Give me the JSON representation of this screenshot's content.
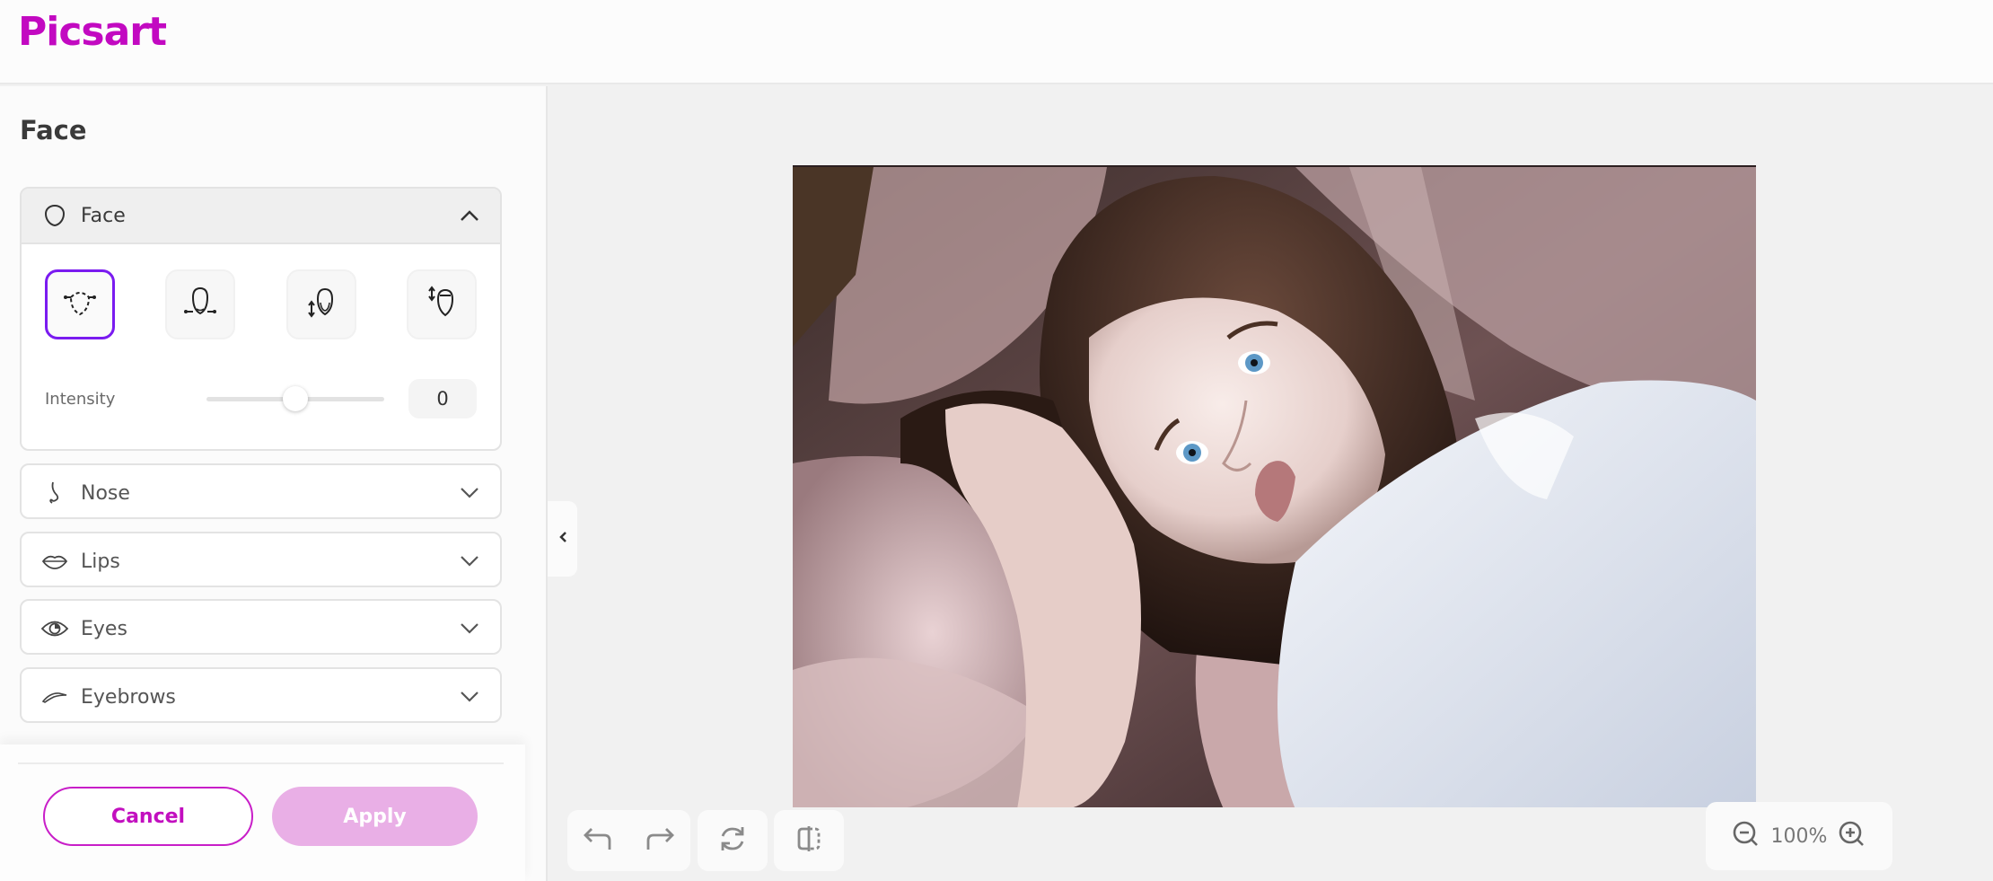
{
  "app": {
    "logo_text": "Picsart",
    "brand_color": "#c209c1"
  },
  "panel": {
    "title": "Face",
    "sections": [
      {
        "id": "face",
        "label": "Face",
        "icon": "face-outline-icon",
        "expanded": true
      },
      {
        "id": "nose",
        "label": "Nose",
        "icon": "nose-icon",
        "expanded": false
      },
      {
        "id": "lips",
        "label": "Lips",
        "icon": "lips-icon",
        "expanded": false
      },
      {
        "id": "eyes",
        "label": "Eyes",
        "icon": "eye-icon",
        "expanded": false
      },
      {
        "id": "eyebrows",
        "label": "Eyebrows",
        "icon": "eyebrow-icon",
        "expanded": false
      }
    ],
    "face_tools": [
      {
        "id": "face-width",
        "icon": "face-width-icon",
        "selected": true
      },
      {
        "id": "jaw-width",
        "icon": "jaw-width-icon",
        "selected": false
      },
      {
        "id": "chin-height",
        "icon": "chin-height-icon",
        "selected": false
      },
      {
        "id": "forehead-height",
        "icon": "forehead-height-icon",
        "selected": false
      }
    ],
    "intensity": {
      "label": "Intensity",
      "value": "0",
      "min": -100,
      "max": 100,
      "current": 0,
      "position_fraction": 0.5
    },
    "selected_color": "#7a1bf0"
  },
  "footer": {
    "cancel_label": "Cancel",
    "apply_label": "Apply",
    "apply_color": "#e9afe6"
  },
  "toolbar": {
    "undo": "undo-icon",
    "redo": "redo-icon",
    "reset": "reset-icon",
    "compare": "compare-icon"
  },
  "zoom": {
    "value": "100%",
    "zoom_out": "zoom-out-icon",
    "zoom_in": "zoom-in-icon"
  },
  "canvas": {
    "image_alt": "Portrait of a woman with blue eyes resting her head on her hand"
  }
}
